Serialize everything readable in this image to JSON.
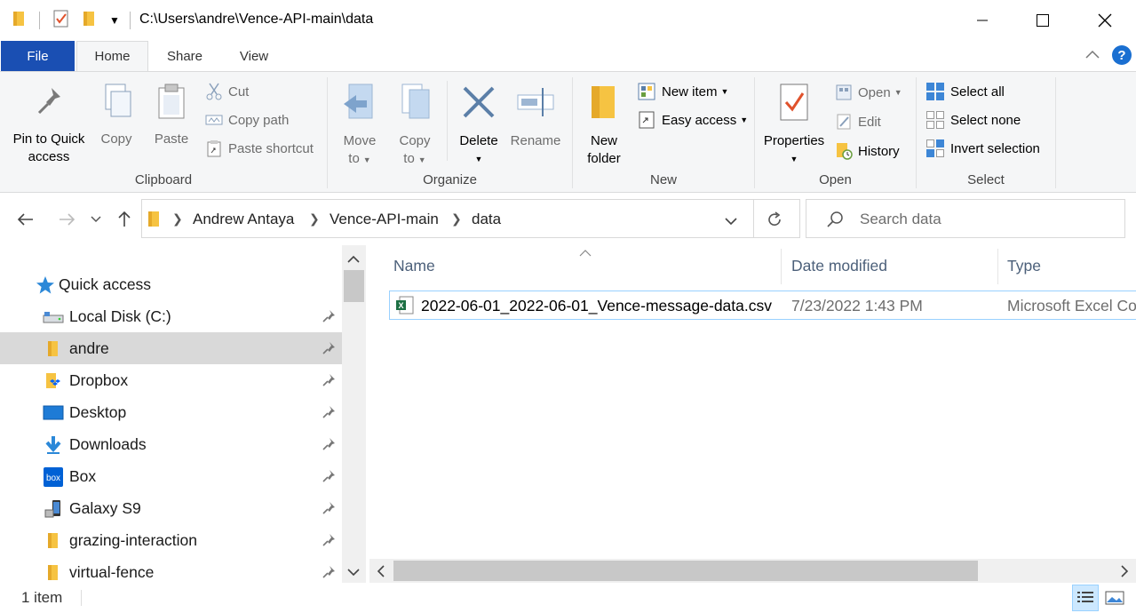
{
  "window": {
    "title": "C:\\Users\\andre\\Vence-API-main\\data",
    "controls": {
      "minimize": "minimize-icon",
      "maximize": "maximize-icon",
      "close": "close-icon"
    }
  },
  "tabs": [
    {
      "label": "File"
    },
    {
      "label": "Home"
    },
    {
      "label": "Share"
    },
    {
      "label": "View"
    }
  ],
  "ribbon": {
    "clipboard": {
      "group_label": "Clipboard",
      "pin_line1": "Pin to Quick",
      "pin_line2": "access",
      "copy": "Copy",
      "paste": "Paste",
      "cut": "Cut",
      "copy_path": "Copy path",
      "paste_shortcut": "Paste shortcut"
    },
    "organize": {
      "group_label": "Organize",
      "move_line1": "Move",
      "move_line2": "to",
      "copy_line1": "Copy",
      "copy_line2": "to",
      "delete": "Delete",
      "rename": "Rename"
    },
    "new": {
      "group_label": "New",
      "folder_line1": "New",
      "folder_line2": "folder",
      "new_item": "New item",
      "easy_access": "Easy access"
    },
    "open": {
      "group_label": "Open",
      "properties": "Properties",
      "open": "Open",
      "edit": "Edit",
      "history": "History"
    },
    "select": {
      "group_label": "Select",
      "select_all": "Select all",
      "select_none": "Select none",
      "invert": "Invert selection"
    }
  },
  "address": {
    "crumbs": [
      "Andrew Antaya",
      "Vence-API-main",
      "data"
    ],
    "search_placeholder": "Search data"
  },
  "nav_pane": {
    "quick_access": "Quick access",
    "items": [
      {
        "label": "Local Disk (C:)",
        "icon": "drive-icon"
      },
      {
        "label": "andre",
        "icon": "folder-icon",
        "selected": true
      },
      {
        "label": "Dropbox",
        "icon": "dropbox-icon"
      },
      {
        "label": "Desktop",
        "icon": "desktop-icon"
      },
      {
        "label": "Downloads",
        "icon": "downloads-icon"
      },
      {
        "label": "Box",
        "icon": "box-icon"
      },
      {
        "label": "Galaxy S9",
        "icon": "phone-icon"
      },
      {
        "label": "grazing-interaction",
        "icon": "folder-icon"
      },
      {
        "label": "virtual-fence",
        "icon": "folder-icon"
      }
    ]
  },
  "file_list": {
    "columns": {
      "name": "Name",
      "date": "Date modified",
      "type": "Type"
    },
    "files": [
      {
        "name": "2022-06-01_2022-06-01_Vence-message-data.csv",
        "date": "7/23/2022 1:43 PM",
        "type": "Microsoft Excel Co"
      }
    ]
  },
  "status": {
    "count": "1 item"
  },
  "colors": {
    "accent": "#1a4fb3",
    "folder": "#f6c342",
    "selection": "#d9d9d9",
    "header_text": "#4c607a"
  }
}
